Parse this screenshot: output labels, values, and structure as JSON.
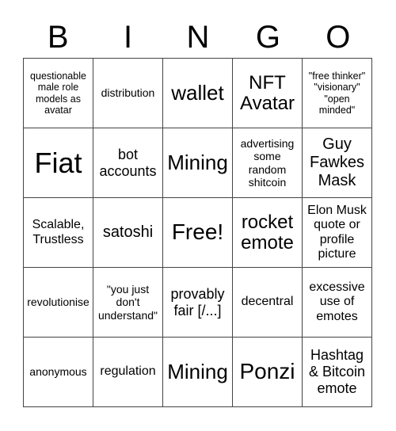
{
  "header": {
    "letters": [
      "B",
      "I",
      "N",
      "G",
      "O"
    ]
  },
  "cells": [
    [
      "questionable male role models as avatar",
      "distribution",
      "wallet",
      "NFT Avatar",
      "\"free thinker\" \"visionary\" \"open minded\""
    ],
    [
      "Fiat",
      "bot accounts",
      "Mining",
      "advertising some random shitcoin",
      "Guy Fawkes Mask"
    ],
    [
      "Scalable, Trustless",
      "satoshi",
      "Free!",
      "rocket emote",
      "Elon Musk quote or profile picture"
    ],
    [
      "revolutionise",
      "\"you just don't understand\"",
      "provably fair [/...]",
      "decentral",
      "excessive use of emotes"
    ],
    [
      "anonymous",
      "regulation",
      "Mining",
      "Ponzi",
      "Hashtag & Bitcoin emote"
    ]
  ]
}
